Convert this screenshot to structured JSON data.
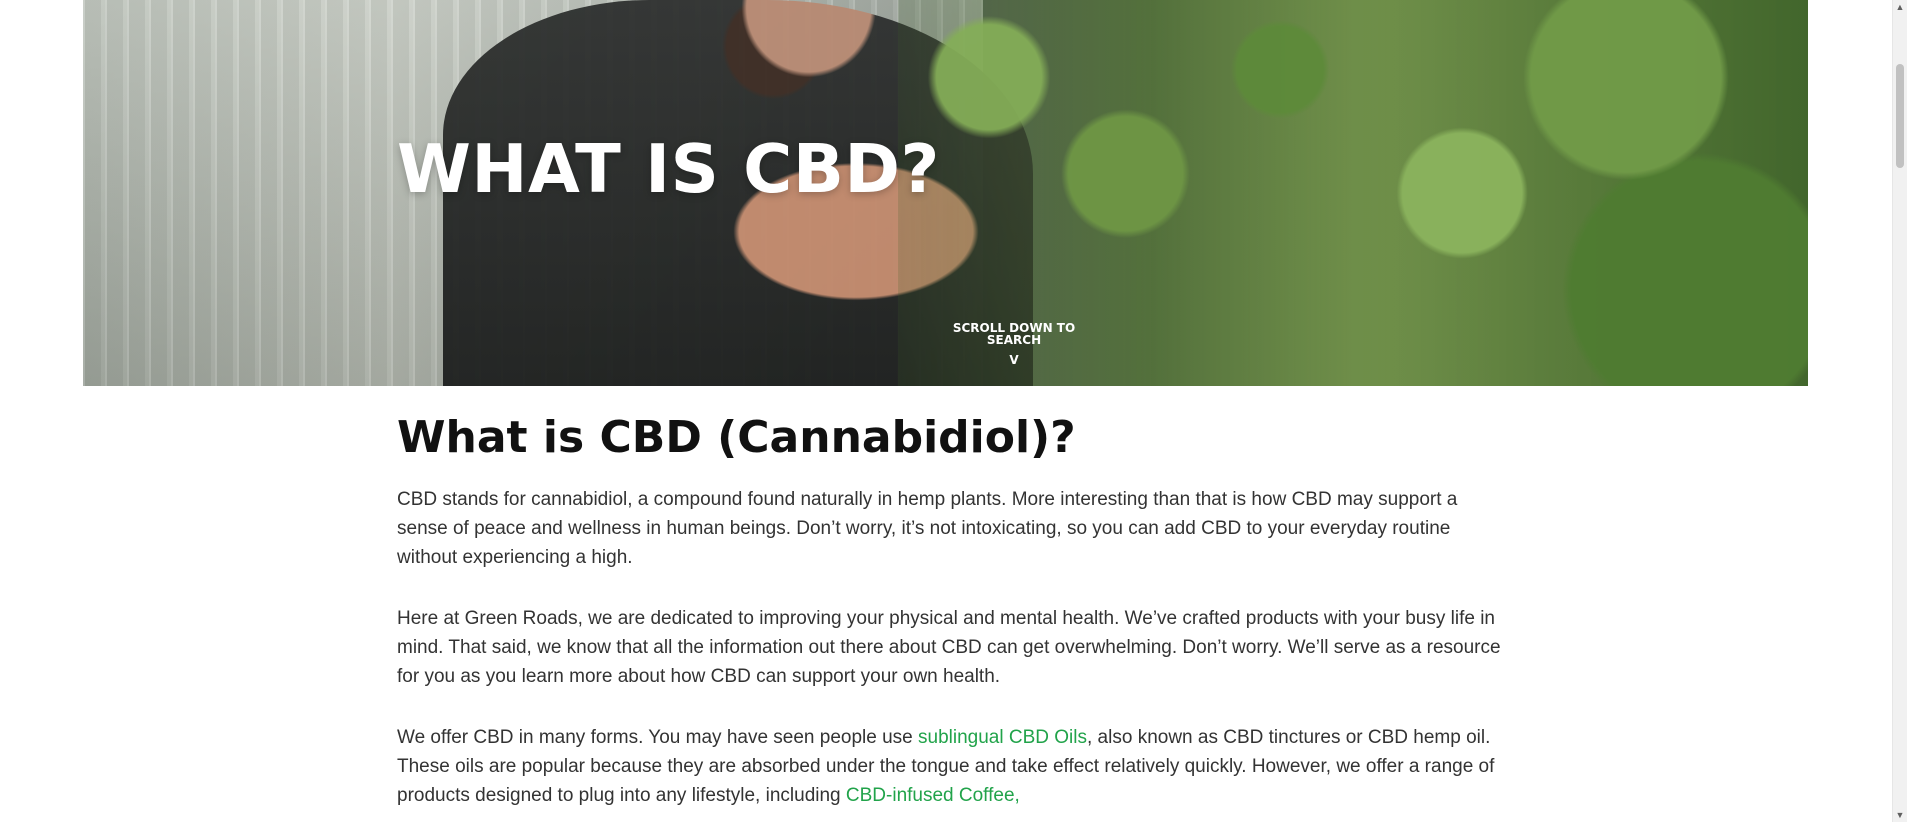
{
  "hero": {
    "title": "WHAT IS CBD?",
    "scroll_text": "SCROLL DOWN TO SEARCH",
    "scroll_arrow": "V",
    "image_subject": "person inspecting hemp plants"
  },
  "content": {
    "heading": "What is CBD (Cannabidiol)?",
    "paragraphs": [
      "CBD stands for cannabidiol, a compound found naturally in hemp plants. More interesting than that is how CBD may support a sense of peace and wellness in human beings. Don’t worry, it’s not intoxicating, so you can add CBD to your everyday routine without experiencing a high.",
      "Here at Green Roads, we are dedicated to improving your physical and mental health. We’ve crafted products with your busy life in mind. That said, we know that all the information out there about CBD can get overwhelming. Don’t worry. We’ll serve as a resource for you as you learn more about how CBD can support your own health."
    ],
    "paragraph_3": {
      "text_1": "We offer CBD in many forms. You may have seen people use ",
      "link_1": "sublingual CBD Oils",
      "text_2": ", also known as CBD tinctures or CBD hemp oil. These oils are popular because they are absorbed under the tongue and take effect relatively quickly. However, we offer a range of products designed to plug into any lifestyle, including ",
      "link_2": "CBD-infused Coffee,"
    }
  },
  "scrollbar": {
    "up_icon": "▲",
    "down_icon": "▼"
  },
  "colors": {
    "link": "#21a34a",
    "heading": "#111111",
    "body_text": "#333333",
    "hero_text": "#ffffff"
  }
}
